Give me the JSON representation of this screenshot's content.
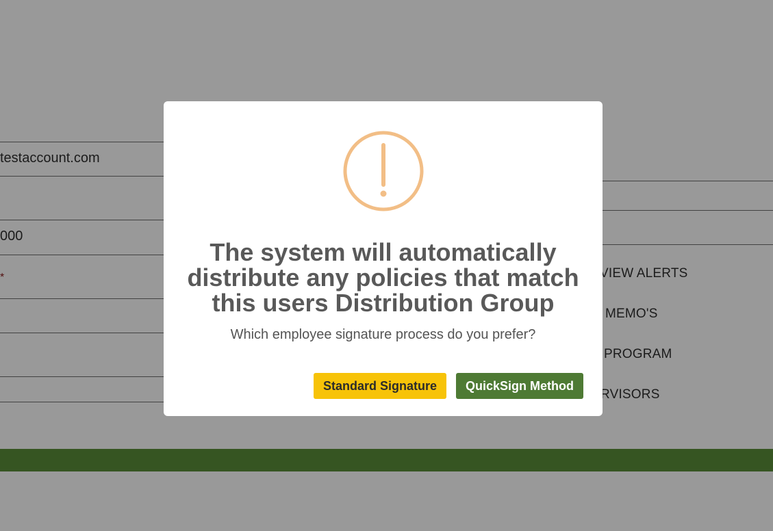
{
  "background": {
    "left_fields": {
      "email_value": "testaccount.com",
      "phone_value": "000",
      "required_marker": "*"
    },
    "right_menu": {
      "items": [
        "VIEW ALERTS",
        "MEMO'S",
        "PROGRAM",
        "RVISORS"
      ]
    }
  },
  "modal": {
    "icon": "warning-exclamation-icon",
    "title": "The system will automatically distribute any policies that match this users Distribution Group",
    "subtitle": "Which employee signature process do you prefer?",
    "buttons": {
      "standard_label": "Standard Signature",
      "quicksign_label": "QuickSign Method"
    }
  },
  "colors": {
    "icon_orange": "#f2be86",
    "standard_button": "#f7c308",
    "quicksign_button": "#4e7a34",
    "footer_bar": "#5a8e3a",
    "title_text": "#595959"
  }
}
